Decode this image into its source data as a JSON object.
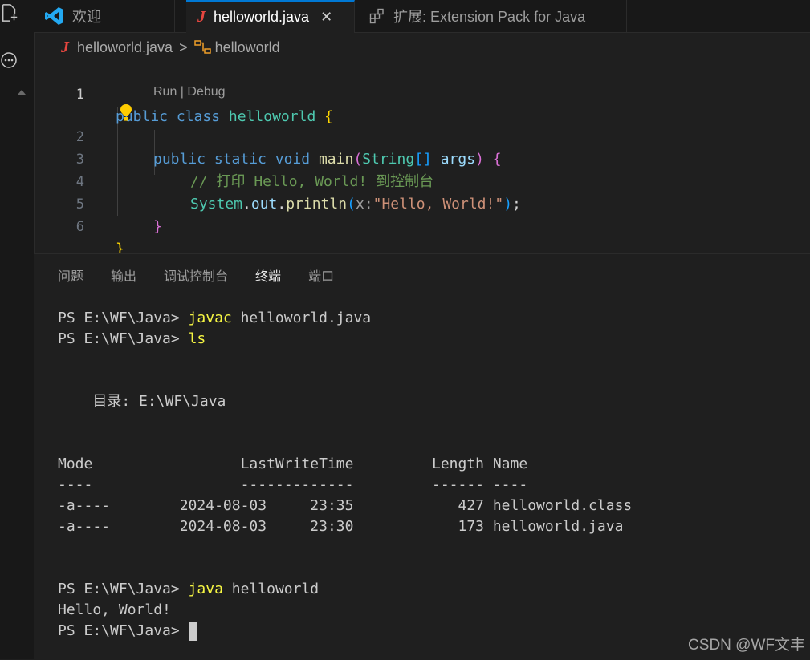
{
  "tabs": [
    {
      "label": "欢迎",
      "icon": "vscode-logo-icon",
      "active": false
    },
    {
      "label": "helloworld.java",
      "icon": "java-file-icon",
      "active": true,
      "close": "✕"
    },
    {
      "label": "扩展: Extension Pack for Java",
      "icon": "extensions-icon",
      "active": false
    }
  ],
  "breadcrumb": {
    "file": "helloworld.java",
    "separator": ">",
    "symbol": "helloworld"
  },
  "editor": {
    "line_numbers": [
      "1",
      "2",
      "3",
      "4",
      "5",
      "6"
    ],
    "codelens": "Run | Debug",
    "lines": {
      "l1": {
        "kw1": "public",
        "kw2": "class",
        "name": "helloworld",
        "brace": "{"
      },
      "l2": {
        "kw1": "public",
        "kw2": "static",
        "kw3": "void",
        "fn": "main",
        "p_open": "(",
        "type": "String",
        "arr": "[]",
        "arg": "args",
        "p_close": ")",
        "brace": "{"
      },
      "l3": {
        "comment": "// 打印 Hello, World! 到控制台"
      },
      "l4": {
        "obj": "System",
        "dot1": ".",
        "field": "out",
        "dot2": ".",
        "fn": "println",
        "p_open": "(",
        "hint": "x:",
        "str": "\"Hello, World!\"",
        "p_close": ")",
        "semi": ";"
      },
      "l5": {
        "brace": "}"
      },
      "l6": {
        "brace": "}"
      }
    }
  },
  "panel": {
    "tabs": [
      {
        "label": "问题",
        "active": false
      },
      {
        "label": "输出",
        "active": false
      },
      {
        "label": "调试控制台",
        "active": false
      },
      {
        "label": "终端",
        "active": true
      },
      {
        "label": "端口",
        "active": false
      }
    ]
  },
  "terminal": {
    "prompt": "PS E:\\WF\\Java> ",
    "cmd1": "javac",
    "cmd1_args": " helloworld.java",
    "cmd2": "ls",
    "dir_line": "    目录: E:\\WF\\Java",
    "header": "Mode                 LastWriteTime         Length Name",
    "divider": "----                 -------------         ------ ----",
    "rows": [
      "-a----        2024-08-03     23:35            427 helloworld.class",
      "-a----        2024-08-03     23:30            173 helloworld.java"
    ],
    "cmd3": "java",
    "cmd3_args": " helloworld",
    "output": "Hello, World!"
  },
  "watermark": "CSDN @WF文丰",
  "colors": {
    "accent": "#0078d4",
    "java_icon": "#e6463f",
    "command": "#f5f543"
  }
}
